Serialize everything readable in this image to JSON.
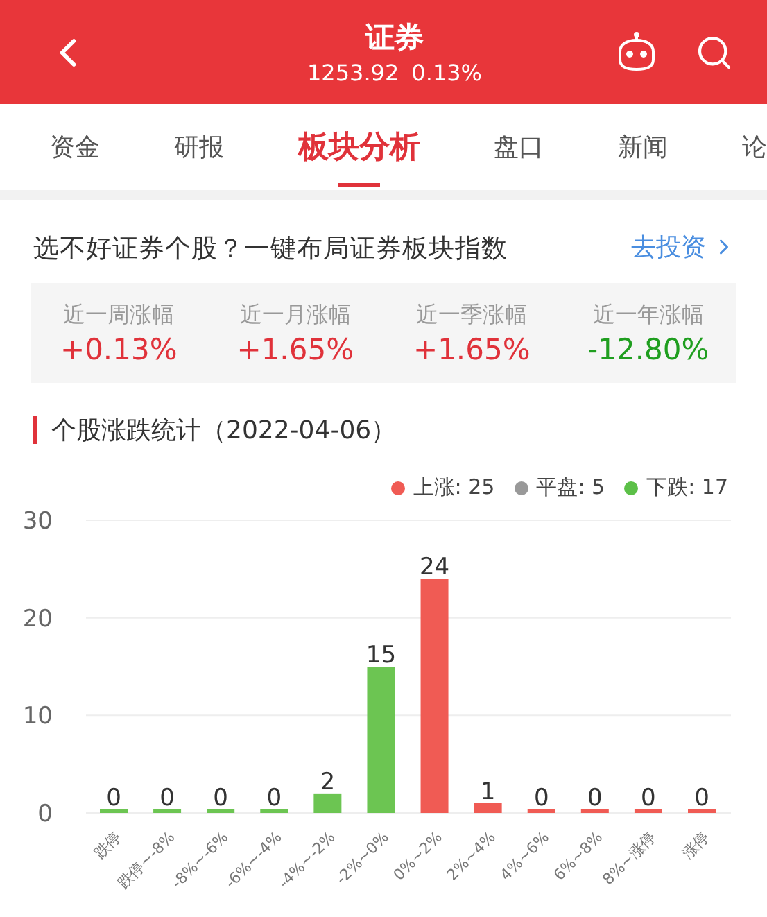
{
  "header": {
    "title": "证券",
    "price": "1253.92",
    "change": "0.13%"
  },
  "tabs": [
    {
      "label": "资金",
      "selected": false
    },
    {
      "label": "研报",
      "selected": false
    },
    {
      "label": "板块分析",
      "selected": true
    },
    {
      "label": "盘口",
      "selected": false
    },
    {
      "label": "新闻",
      "selected": false
    },
    {
      "label": "论",
      "selected": false
    }
  ],
  "promo": {
    "text": "选不好证券个股？一键布局证券板块指数",
    "link": "去投资"
  },
  "stats": [
    {
      "label": "近一周涨幅",
      "value": "+0.13%",
      "color": "#e0323a"
    },
    {
      "label": "近一月涨幅",
      "value": "+1.65%",
      "color": "#e0323a"
    },
    {
      "label": "近一季涨幅",
      "value": "+1.65%",
      "color": "#e0323a"
    },
    {
      "label": "近一年涨幅",
      "value": "-12.80%",
      "color": "#1f9e1f"
    }
  ],
  "section_title": "个股涨跌统计（2022-04-06）",
  "legend": [
    {
      "label": "上涨: 25",
      "color": "#f05b54"
    },
    {
      "label": "平盘: 5",
      "color": "#999999"
    },
    {
      "label": "下跌: 17",
      "color": "#5cc048"
    }
  ],
  "chart_data": {
    "type": "bar",
    "categories": [
      "跌停",
      "跌停~-8%",
      "-8%~-6%",
      "-6%~-4%",
      "-4%~-2%",
      "-2%~0%",
      "0%~2%",
      "2%~4%",
      "4%~6%",
      "6%~8%",
      "8%~涨停",
      "涨停"
    ],
    "series": [
      {
        "color": "#6cc552",
        "values": [
          0,
          0,
          0,
          0,
          2,
          15,
          null,
          null,
          null,
          null,
          null,
          null
        ]
      },
      {
        "color": "#f05b54",
        "values": [
          null,
          null,
          null,
          null,
          null,
          null,
          24,
          1,
          0,
          0,
          0,
          0
        ]
      }
    ],
    "ylim": [
      0,
      30
    ],
    "yticks": [
      0,
      10,
      20,
      30
    ],
    "stacked": true,
    "data_labels": true
  }
}
